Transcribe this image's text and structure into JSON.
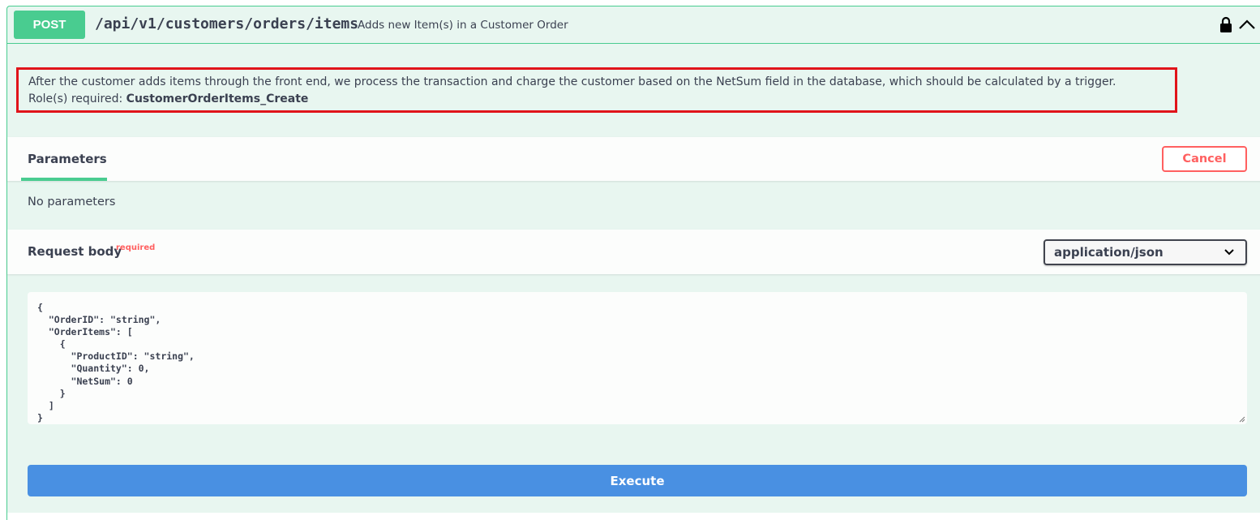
{
  "operation": {
    "method": "POST",
    "path": "/api/v1/customers/orders/items",
    "summary": "Adds new Item(s) in a Customer Order",
    "icons": {
      "lock": "lock-icon",
      "collapse": "chevron-up-icon"
    }
  },
  "description": {
    "text": "After the customer adds items through the front end, we process the transaction and charge the customer based on the NetSum field in the database, which should be calculated by a trigger.",
    "role_label": "Role(s) required:",
    "role_name": "CustomerOrderItems_Create"
  },
  "parameters": {
    "tab_label": "Parameters",
    "cancel_label": "Cancel",
    "empty_text": "No parameters"
  },
  "request_body": {
    "title": "Request body",
    "required_label": "required",
    "content_type": "application/json",
    "example": "{\n  \"OrderID\": \"string\",\n  \"OrderItems\": [\n    {\n      \"ProductID\": \"string\",\n      \"Quantity\": 0,\n      \"NetSum\": 0\n    }\n  ]\n}"
  },
  "execute_label": "Execute",
  "colors": {
    "post_green": "#49cc90",
    "cancel_red": "#ff6060",
    "execute_blue": "#4990e2",
    "highlight_red": "#e0141a"
  }
}
